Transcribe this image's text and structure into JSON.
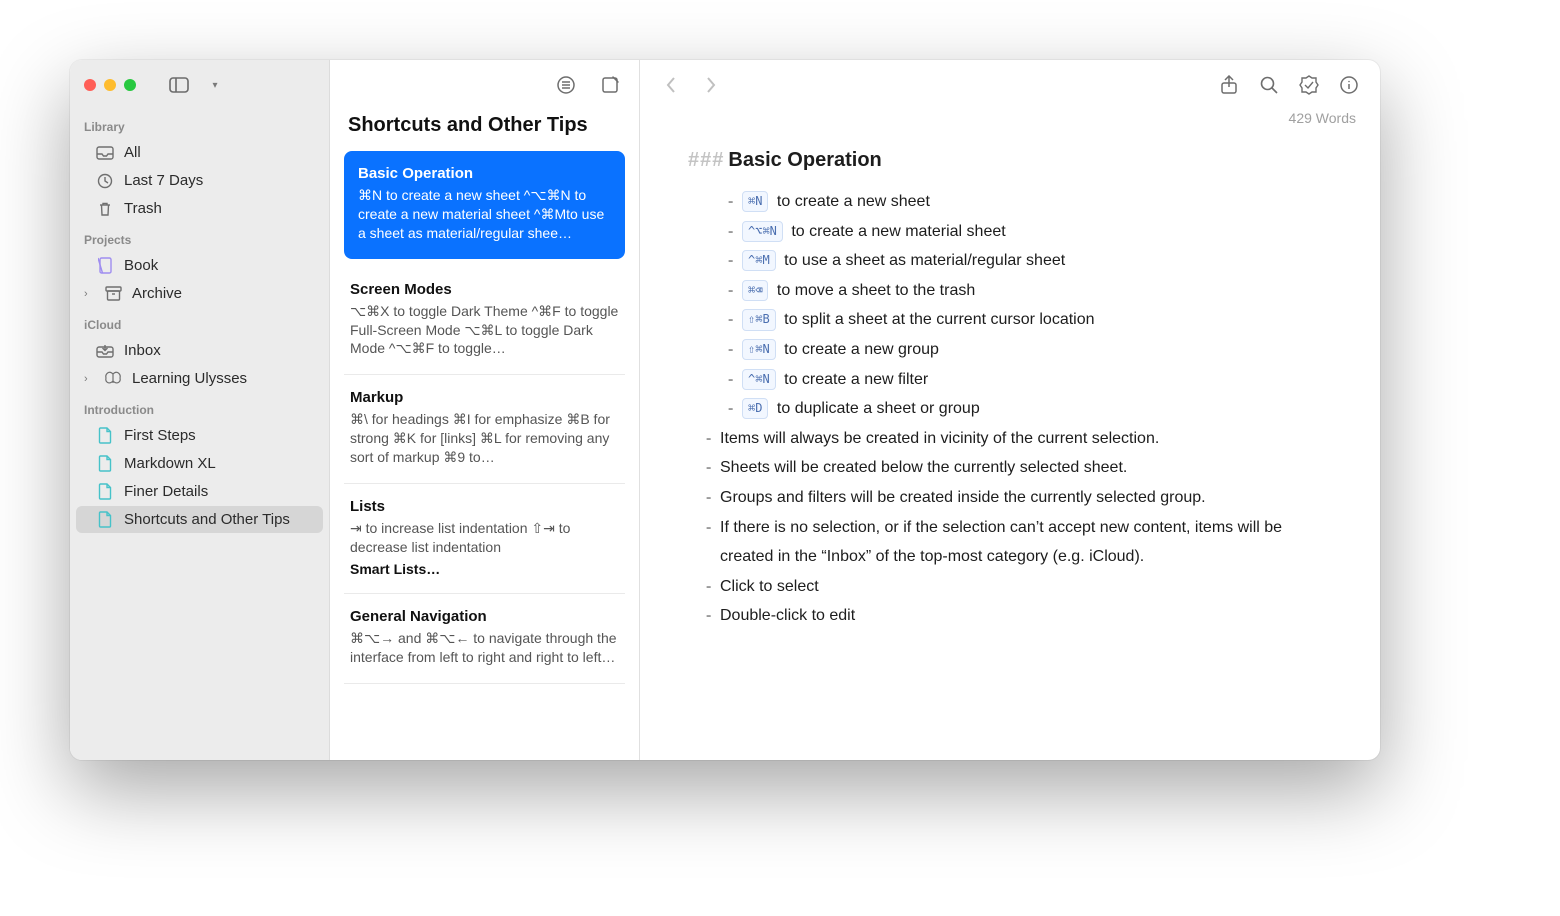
{
  "sidebar": {
    "sections": [
      {
        "label": "Library",
        "items": [
          {
            "icon": "tray-icon",
            "label": "All"
          },
          {
            "icon": "clock-icon",
            "label": "Last 7 Days"
          },
          {
            "icon": "trash-icon",
            "label": "Trash"
          }
        ]
      },
      {
        "label": "Projects",
        "items": [
          {
            "icon": "book-icon",
            "label": "Book",
            "kind": "proj"
          },
          {
            "icon": "archive-icon",
            "label": "Archive",
            "chev": true
          }
        ]
      },
      {
        "label": "iCloud",
        "items": [
          {
            "icon": "inbox-icon",
            "label": "Inbox"
          },
          {
            "icon": "butterfly-icon",
            "label": "Learning Ulysses",
            "chev": true
          }
        ]
      },
      {
        "label": "Introduction",
        "items": [
          {
            "icon": "doc-icon",
            "label": "First Steps",
            "kind": "intro"
          },
          {
            "icon": "doc-icon",
            "label": "Markdown XL",
            "kind": "intro"
          },
          {
            "icon": "doc-icon",
            "label": "Finer Details",
            "kind": "intro"
          },
          {
            "icon": "doc-icon",
            "label": "Shortcuts and Other Tips",
            "kind": "intro",
            "selected": true
          }
        ]
      }
    ]
  },
  "middle": {
    "title": "Shortcuts and Other Tips",
    "cards": [
      {
        "title": "Basic Operation",
        "body": "⌘N to create a new sheet ^⌥⌘N to create a new material sheet ^⌘Mto use a sheet as material/regular shee…",
        "active": true
      },
      {
        "title": "Screen Modes",
        "body": "⌥⌘X to toggle Dark Theme ^⌘F to toggle Full-Screen Mode ⌥⌘L to toggle Dark Mode ^⌥⌘F to toggle…"
      },
      {
        "title": "Markup",
        "body": "⌘\\ for headings ⌘I for emphasize ⌘B for strong ⌘K for [links] ⌘L for removing any sort of markup ⌘9 to…"
      },
      {
        "title": "Lists",
        "body": "⇥ to increase list indentation ⇧⇥ to decrease list indentation",
        "sub": "Smart Lists…"
      },
      {
        "title": "General Navigation",
        "body": "⌘⌥→ and ⌘⌥← to navigate through the interface from left to right and right to left…"
      }
    ]
  },
  "editor": {
    "word_count": "429 Words",
    "markdown_hashes": "###",
    "heading": "Basic Operation",
    "shortcut_items": [
      {
        "kbd": "⌘N",
        "text": "to create a new sheet"
      },
      {
        "kbd": "^⌥⌘N",
        "text": "to create a new material sheet"
      },
      {
        "kbd": "^⌘M",
        "text": "to use a sheet as material/regular sheet"
      },
      {
        "kbd": "⌘⌫",
        "text": "to move a sheet to the trash"
      },
      {
        "kbd": "⇧⌘B",
        "text": "to split a sheet at the current cursor location"
      },
      {
        "kbd": "⇧⌘N",
        "text": "to create a new group"
      },
      {
        "kbd": "^⌘N",
        "text": "to create a new filter"
      },
      {
        "kbd": "⌘D",
        "text": "to duplicate a sheet or group"
      }
    ],
    "bullets": [
      "Items will always be created in vicinity of the current selection.",
      "Sheets will be created below the currently selected sheet.",
      "Groups and filters will be created inside the currently selected group.",
      "If there is no selection, or if the selection can’t accept new content, items will be created in the “Inbox” of the top-most category (e.g. iCloud).",
      "Click to select",
      "Double-click to edit"
    ]
  }
}
